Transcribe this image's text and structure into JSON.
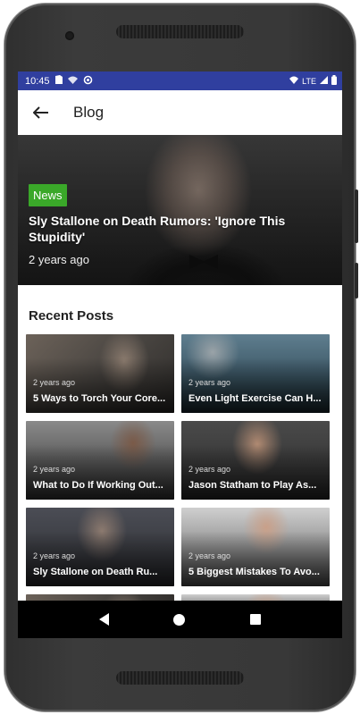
{
  "status_bar": {
    "time": "10:45",
    "network": "LTE",
    "bg_color": "#303f9f"
  },
  "app_bar": {
    "back_icon": "arrow-left-icon",
    "title": "Blog"
  },
  "featured": {
    "badge": "News",
    "badge_color": "#3aa829",
    "title": "Sly Stallone on Death Rumors: 'Ignore This Stupidity'",
    "time": "2 years ago"
  },
  "recent": {
    "heading": "Recent Posts",
    "posts": [
      {
        "time": "2 years ago",
        "title": "5 Ways to Torch Your Core..."
      },
      {
        "time": "2 years ago",
        "title": "Even Light Exercise Can H..."
      },
      {
        "time": "2 years ago",
        "title": "What to Do If Working Out..."
      },
      {
        "time": "2 years ago",
        "title": "Jason Statham to Play As..."
      },
      {
        "time": "2 years ago",
        "title": "Sly Stallone on Death Ru..."
      },
      {
        "time": "2 years ago",
        "title": "5 Biggest Mistakes To Avo..."
      }
    ]
  },
  "nav_bar": {
    "back": "nav-back-icon",
    "home": "nav-home-icon",
    "recents": "nav-recents-icon"
  }
}
